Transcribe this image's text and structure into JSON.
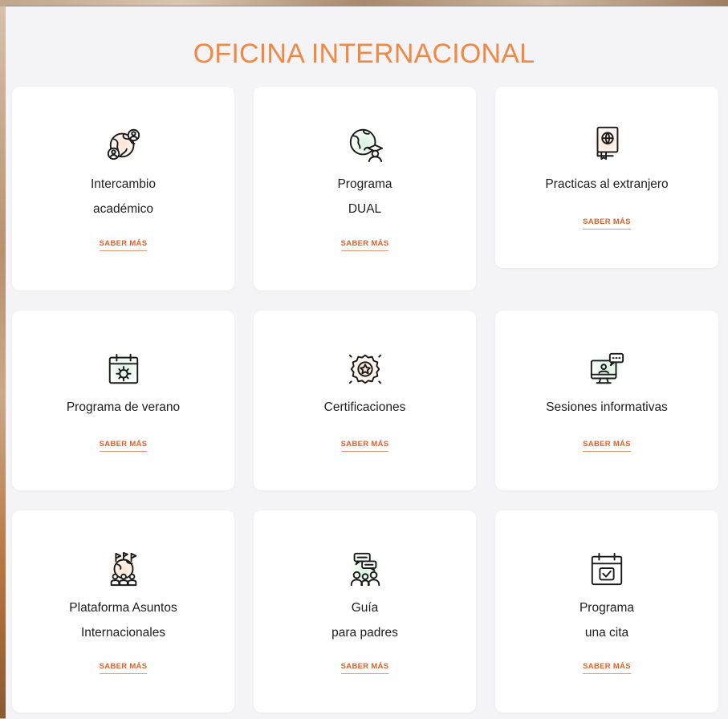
{
  "title": "OFICINA INTERNACIONAL",
  "more_label": "SABER MÁS",
  "colors": {
    "accent": "#ee8a45",
    "link": "#d9622b",
    "glow_orange": "#fde3d2",
    "glow_green": "#d8f1df"
  },
  "cards": [
    {
      "icon": "globe-people-icon",
      "lines": [
        "Intercambio",
        "académico"
      ]
    },
    {
      "icon": "globe-graduate-icon",
      "lines": [
        "Programa",
        "DUAL"
      ]
    },
    {
      "icon": "passport-book-icon",
      "lines": [
        "Practicas al extranjero"
      ]
    },
    {
      "icon": "calendar-sun-icon",
      "lines": [
        "Programa de verano"
      ]
    },
    {
      "icon": "award-badge-icon",
      "lines": [
        "Certificaciones"
      ]
    },
    {
      "icon": "monitor-chat-icon",
      "lines": [
        "Sesiones informativas"
      ]
    },
    {
      "icon": "globe-flags-people-icon",
      "lines": [
        "Plataforma Asuntos",
        "Internacionales"
      ]
    },
    {
      "icon": "parents-chat-icon",
      "lines": [
        "Guía",
        "para padres"
      ]
    },
    {
      "icon": "calendar-check-icon",
      "lines": [
        "Programa",
        "una cita"
      ]
    }
  ]
}
